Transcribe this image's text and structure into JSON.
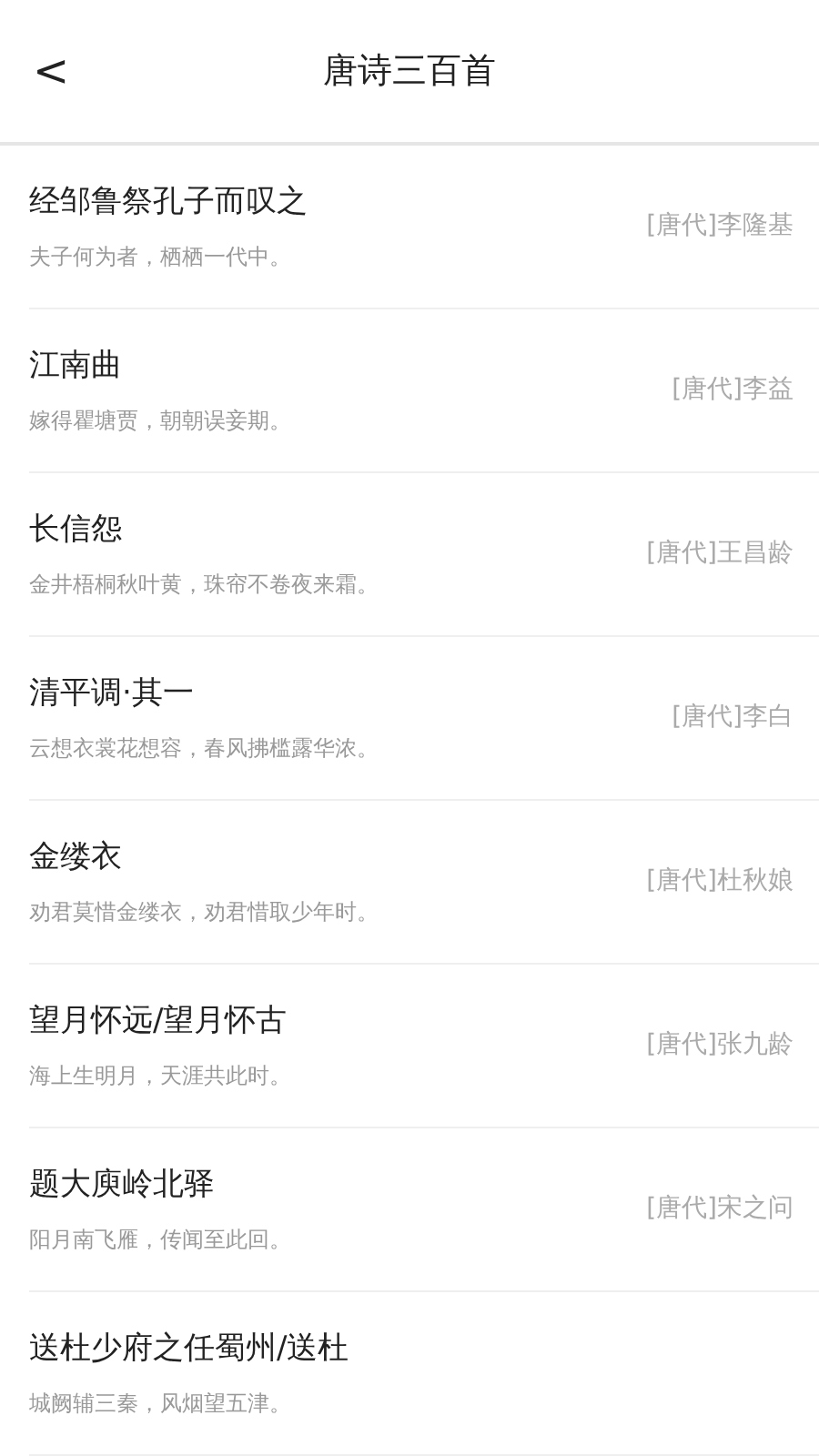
{
  "header": {
    "back": "<",
    "title": "唐诗三百首"
  },
  "poems": [
    {
      "title": "经邹鲁祭孔子而叹之",
      "line": "夫子何为者，栖栖一代中。",
      "author": "[唐代]李隆基"
    },
    {
      "title": "江南曲",
      "line": "嫁得瞿塘贾，朝朝误妾期。",
      "author": "[唐代]李益"
    },
    {
      "title": "长信怨",
      "line": "金井梧桐秋叶黄，珠帘不卷夜来霜。",
      "author": "[唐代]王昌龄"
    },
    {
      "title": "清平调·其一",
      "line": "云想衣裳花想容，春风拂槛露华浓。",
      "author": "[唐代]李白"
    },
    {
      "title": "金缕衣",
      "line": "劝君莫惜金缕衣，劝君惜取少年时。",
      "author": "[唐代]杜秋娘"
    },
    {
      "title": "望月怀远/望月怀古",
      "line": "海上生明月，天涯共此时。",
      "author": "[唐代]张九龄"
    },
    {
      "title": "题大庾岭北驿",
      "line": "阳月南飞雁，传闻至此回。",
      "author": "[唐代]宋之问"
    },
    {
      "title": "送杜少府之任蜀州/送杜",
      "line": "城阙辅三秦，风烟望五津。"
    }
  ]
}
